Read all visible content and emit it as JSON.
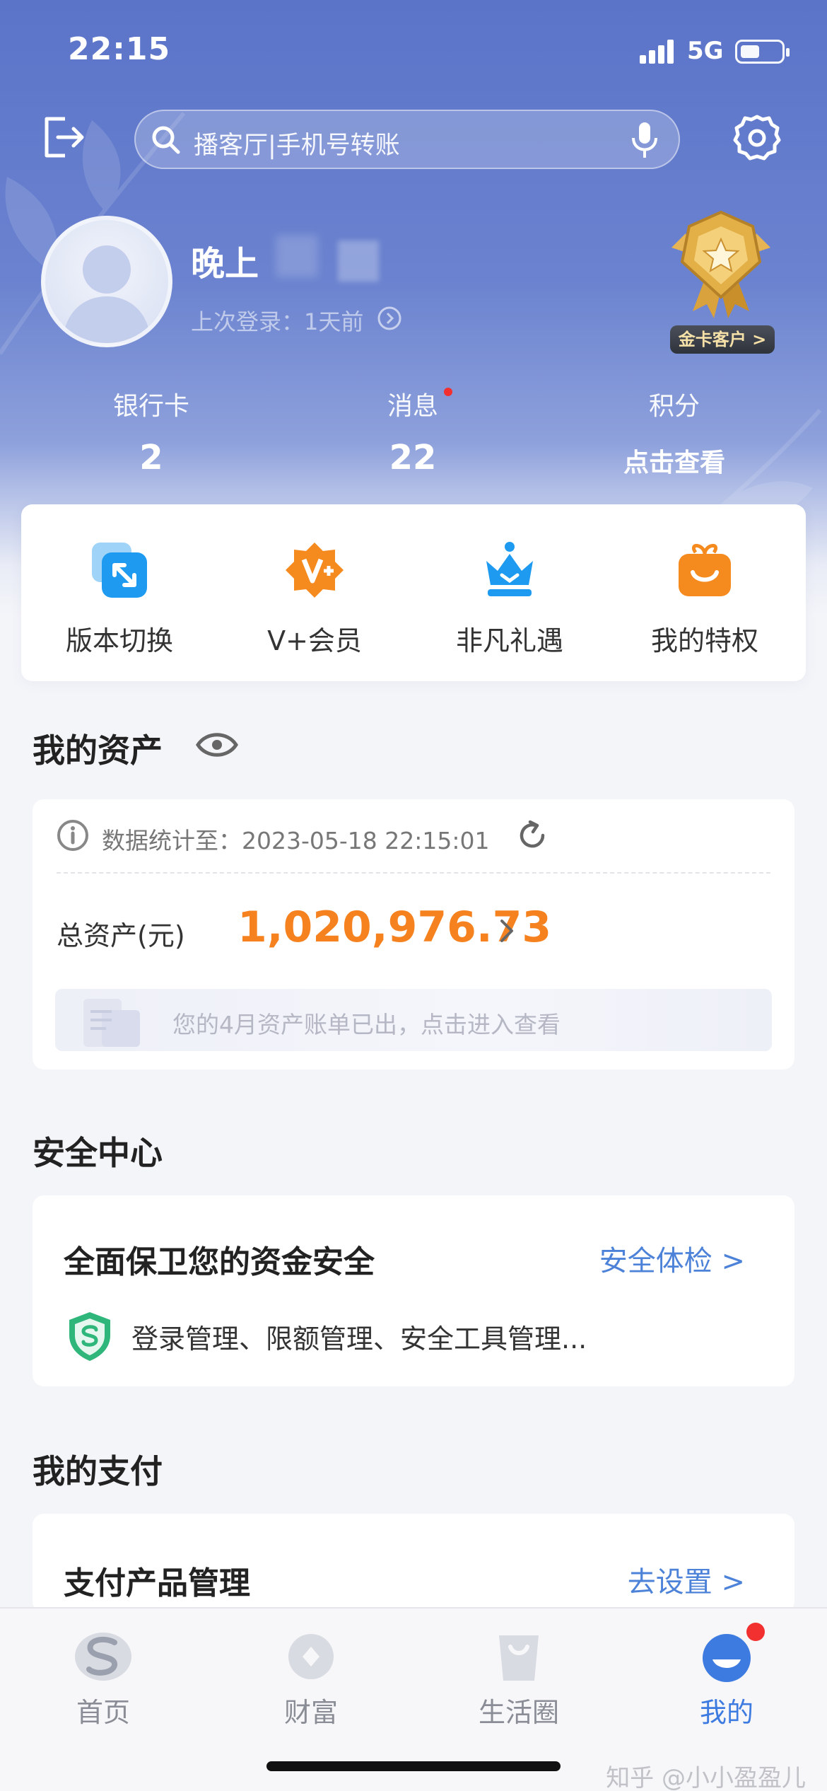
{
  "status_bar": {
    "time": "22:15",
    "network": "5G"
  },
  "search": {
    "placeholder": "播客厅|手机号转账"
  },
  "profile": {
    "name": "晚上",
    "last_login": "上次登录：1天前",
    "tier": "金卡客户 >"
  },
  "stats": [
    {
      "label": "银行卡",
      "value": "2"
    },
    {
      "label": "消息",
      "value": "22"
    },
    {
      "label": "积分",
      "value": "点击查看"
    }
  ],
  "quick_actions": [
    {
      "label": "版本切换",
      "icon": "switch-icon"
    },
    {
      "label": "V+会员",
      "icon": "vplus-icon"
    },
    {
      "label": "非凡礼遇",
      "icon": "crown-icon"
    },
    {
      "label": "我的特权",
      "icon": "gift-icon"
    }
  ],
  "assets": {
    "title": "我的资产",
    "stat_time": "数据统计至：2023-05-18 22:15:01",
    "total_label": "总资产(元)",
    "total_value": "1,020,976.73",
    "bill_notice": "您的4月资产账单已出，点击进入查看"
  },
  "security": {
    "title": "安全中心",
    "heading": "全面保卫您的资金安全",
    "link": "安全体检 >",
    "desc": "登录管理、限额管理、安全工具管理..."
  },
  "payment": {
    "title": "我的支付",
    "heading": "支付产品管理",
    "link": "去设置 >"
  },
  "tabs": [
    {
      "label": "首页",
      "icon": "home-logo-icon"
    },
    {
      "label": "财富",
      "icon": "wealth-icon"
    },
    {
      "label": "生活圈",
      "icon": "bag-icon"
    },
    {
      "label": "我的",
      "icon": "mine-icon"
    }
  ],
  "watermark": "知乎 @小小盈盈儿",
  "colors": {
    "accent": "#3d7be0",
    "asset_orange": "#f5821f",
    "hero": "#5c74c8"
  }
}
